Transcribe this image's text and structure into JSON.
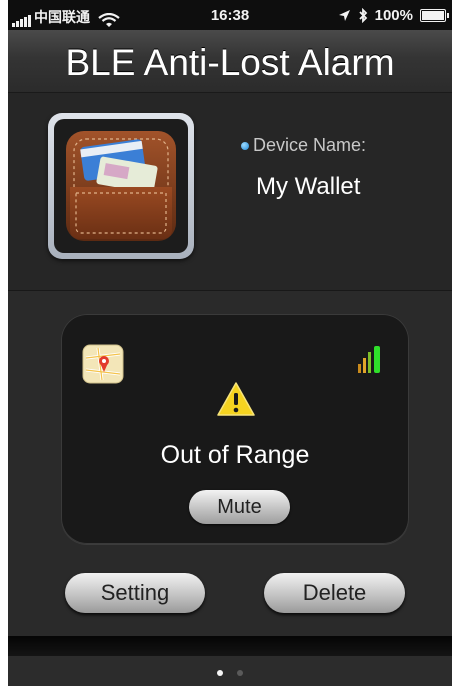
{
  "status_bar": {
    "carrier": "中国联通",
    "time": "16:38",
    "battery_text": "100%",
    "battery_level": 1.0
  },
  "app": {
    "title": "BLE Anti-Lost Alarm"
  },
  "device": {
    "label": "Device Name:",
    "name": "My Wallet",
    "icon": "wallet-icon"
  },
  "status_card": {
    "status_text": "Out of Range",
    "mute_label": "Mute",
    "icons": [
      "map-icon",
      "signal-strength-icon",
      "warning-icon"
    ]
  },
  "actions": {
    "setting_label": "Setting",
    "delete_label": "Delete"
  },
  "pagination": {
    "page_count": 2,
    "current_page": 1
  },
  "colors": {
    "background": "#2a2a2a",
    "card": "#191919",
    "accent_dot": "#1c86d6",
    "warning": "#f5d320",
    "signal_green": "#2fe02a"
  }
}
